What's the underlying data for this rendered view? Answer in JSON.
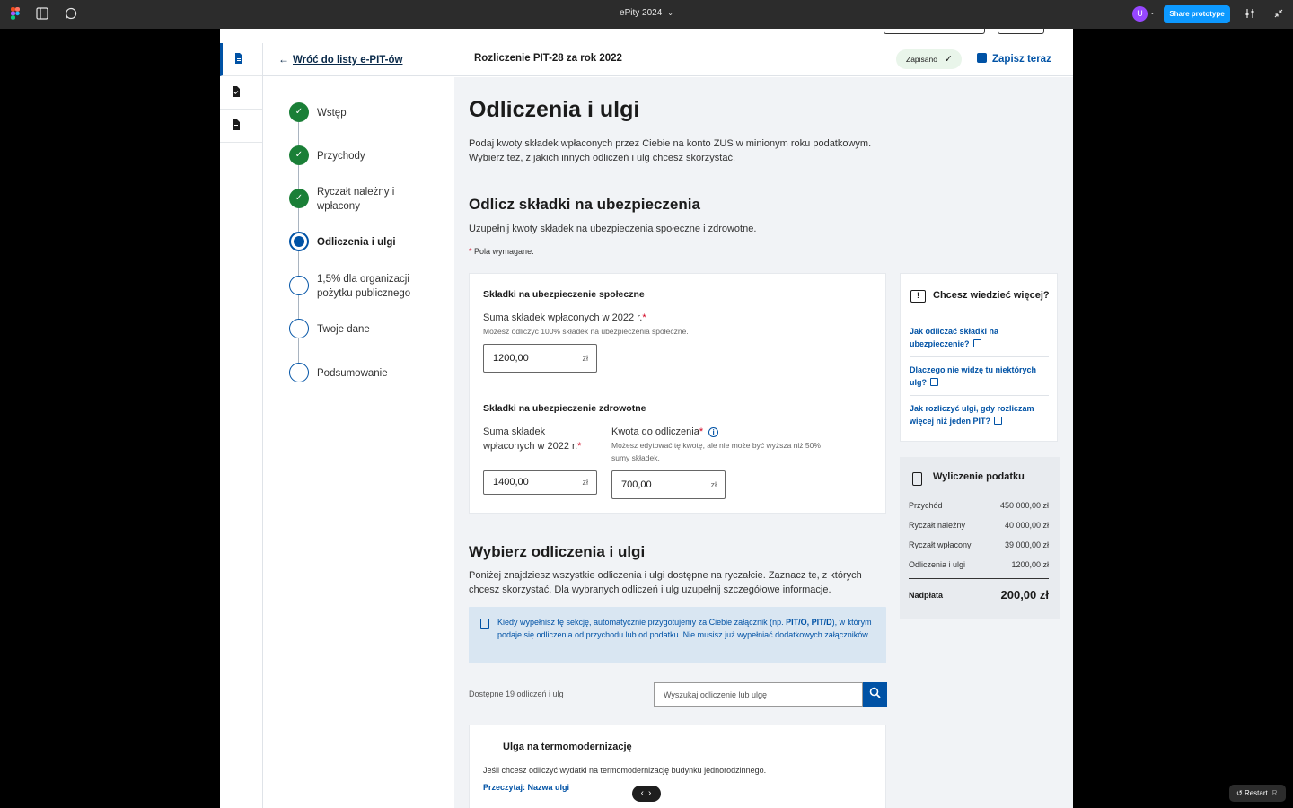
{
  "topbar": {
    "title": "ePity 2024",
    "avatar_initial": "U",
    "share_label": "Share prototype"
  },
  "header": {
    "back_label": "Wróć do listy e-PIT-ów",
    "title": "Rozliczenie PIT-28 za rok 2022",
    "saved_badge": "Zapisano",
    "save_now": "Zapisz teraz"
  },
  "steps": [
    {
      "label": "Wstęp",
      "state": "done"
    },
    {
      "label": "Przychody",
      "state": "done"
    },
    {
      "label": "Ryczałt należny i wpłacony",
      "state": "done"
    },
    {
      "label": "Odliczenia i ulgi",
      "state": "current"
    },
    {
      "label": "1,5% dla organizacji pożytku publicznego",
      "state": "todo"
    },
    {
      "label": "Twoje dane",
      "state": "todo"
    },
    {
      "label": "Podsumowanie",
      "state": "todo"
    }
  ],
  "main": {
    "title": "Odliczenia i ulgi",
    "intro": "Podaj kwoty składek wpłaconych przez Ciebie na konto ZUS w minionym roku podatkowym. Wybierz też, z jakich innych odliczeń i ulg chcesz skorzystać.",
    "section1_title": "Odlicz składki na ubezpieczenia",
    "section1_desc": "Uzupełnij kwoty składek na ubezpieczenia społeczne i zdrowotne.",
    "required_note": "Pola wymagane.",
    "social": {
      "title": "Składki na ubezpieczenie społeczne",
      "label": "Suma składek wpłaconych w 2022 r.",
      "hint": "Możesz odliczyć 100% składek na ubezpieczenia społeczne.",
      "value": "1200,00",
      "unit": "zł"
    },
    "health": {
      "title": "Składki na ubezpieczenie zdrowotne",
      "sum_label": "Suma składek wpłaconych w 2022 r.",
      "sum_value": "1400,00",
      "deduct_label": "Kwota do odliczenia",
      "deduct_hint": "Możesz edytować tę kwotę, ale nie może być wyższa niż 50% sumy składek.",
      "deduct_value": "700,00",
      "unit": "zł"
    },
    "section2_title": "Wybierz odliczenia i ulgi",
    "section2_desc": "Poniżej znajdziesz wszystkie odliczenia i ulgi dostępne na ryczałcie. Zaznacz te, z których chcesz skorzystać. Dla wybranych odliczeń i ulg uzupełnij szczegółowe informacje.",
    "info_text_1": "Kiedy wypełnisz tę sekcję, automatycznie przygotujemy za Ciebie załącznik (np. ",
    "info_text_bold": "PIT/O, PIT/D",
    "info_text_2": "), w którym podaje się odliczenia od przychodu lub od podatku. Nie musisz już wypełniać dodatkowych załączników.",
    "available": "Dostępne 19 odliczeń i ulg",
    "search_placeholder": "Wyszukaj odliczenie lub ulgę",
    "ulga": {
      "title": "Ulga na termomodernizację",
      "desc": "Jeśli chcesz odliczyć wydatki na termomodernizację budynku jednorodzinnego.",
      "link": "Przeczytaj: Nazwa ulgi"
    }
  },
  "side_info": {
    "title": "Chcesz wiedzieć więcej?",
    "links": [
      "Jak odliczać składki na ubezpieczenie?",
      "Dlaczego nie widzę tu niektórych ulg?",
      "Jak rozliczyć ulgi, gdy rozliczam więcej niż jeden PIT?"
    ]
  },
  "tax_calc": {
    "title": "Wyliczenie podatku",
    "rows": [
      {
        "label": "Przychód",
        "value": "450 000,00 zł"
      },
      {
        "label": "Ryczałt należny",
        "value": "40 000,00 zł"
      },
      {
        "label": "Ryczałt wpłacony",
        "value": "39 000,00 zł"
      },
      {
        "label": "Odliczenia i ulgi",
        "value": "1200,00 zł"
      }
    ],
    "total_label": "Nadpłata",
    "total_value": "200,00 zł"
  },
  "player": {
    "restart": "Restart",
    "restart_key": "R"
  },
  "colors": {
    "accent": "#0052a5",
    "done": "#1a7f37",
    "share": "#0d99ff"
  }
}
